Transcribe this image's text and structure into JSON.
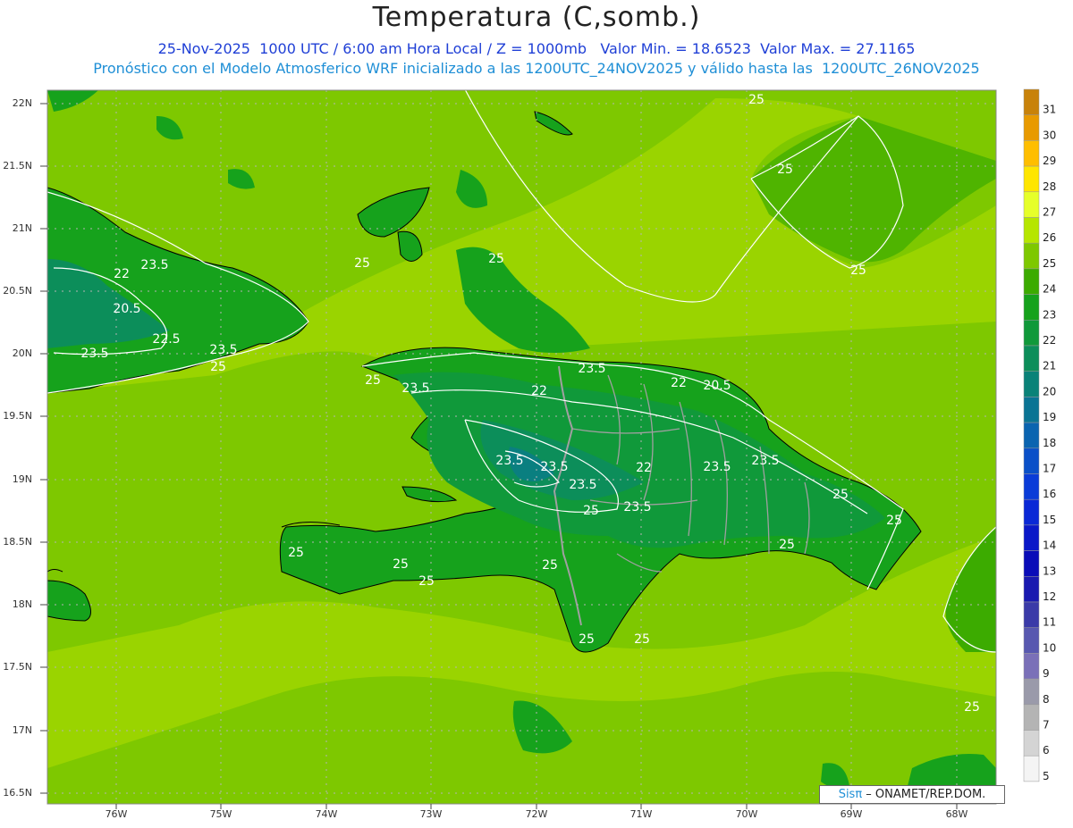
{
  "header": {
    "title": "Temperatura (C,somb.)",
    "line1": "25-Nov-2025  1000 UTC / 6:00 am Hora Local / Z = 1000mb   Valor Min. = 18.6523  Valor Max. = 27.1165",
    "line2": "Pronóstico con el Modelo Atmosferico WRF inicializado a las 1200UTC_24NOV2025 y válido hasta las  1200UTC_26NOV2025"
  },
  "axes": {
    "lat_labels": [
      "22N",
      "21.5N",
      "21N",
      "20.5N",
      "20N",
      "19.5N",
      "19N",
      "18.5N",
      "18N",
      "17.5N",
      "17N",
      "16.5N"
    ],
    "lon_labels": [
      "76W",
      "75W",
      "74W",
      "73W",
      "72W",
      "71W",
      "70W",
      "69W",
      "68W"
    ]
  },
  "legend": {
    "levels": [
      {
        "label": "31",
        "color": "#c8820a"
      },
      {
        "label": "30",
        "color": "#e89a00"
      },
      {
        "label": "29",
        "color": "#ffbe00"
      },
      {
        "label": "28",
        "color": "#ffe600"
      },
      {
        "label": "27",
        "color": "#e6ff2a"
      },
      {
        "label": "26",
        "color": "#b6e600"
      },
      {
        "label": "25",
        "color": "#7ec800"
      },
      {
        "label": "24",
        "color": "#3cab00"
      },
      {
        "label": "23",
        "color": "#16a21c"
      },
      {
        "label": "22",
        "color": "#10993a"
      },
      {
        "label": "21",
        "color": "#0c8e5a"
      },
      {
        "label": "20",
        "color": "#0a8278"
      },
      {
        "label": "19",
        "color": "#0a7494"
      },
      {
        "label": "18",
        "color": "#0a64b0"
      },
      {
        "label": "17",
        "color": "#0a50c8"
      },
      {
        "label": "16",
        "color": "#0a3cd8"
      },
      {
        "label": "15",
        "color": "#0a28d6"
      },
      {
        "label": "14",
        "color": "#0a18c8"
      },
      {
        "label": "13",
        "color": "#0a0cb8"
      },
      {
        "label": "12",
        "color": "#1a1ab0"
      },
      {
        "label": "11",
        "color": "#3a3aa8"
      },
      {
        "label": "10",
        "color": "#5858b0"
      },
      {
        "label": "9",
        "color": "#7a70b8"
      },
      {
        "label": "8",
        "color": "#9a9aaa"
      },
      {
        "label": "7",
        "color": "#b4b4b4"
      },
      {
        "label": "6",
        "color": "#d4d4d4"
      },
      {
        "label": "5",
        "color": "#f4f4f4"
      }
    ]
  },
  "contour_labels": [
    "25",
    "25",
    "25",
    "25",
    "23.5",
    "22",
    "20.5",
    "22.5",
    "23.5",
    "23.5",
    "25",
    "25",
    "23.5",
    "22",
    "25",
    "23.5",
    "22",
    "20.5",
    "23.5",
    "23.5",
    "23.5",
    "22",
    "23.5",
    "23.5",
    "25",
    "23.5",
    "25",
    "25",
    "25",
    "25",
    "25",
    "25",
    "25",
    "25",
    "25",
    "25"
  ],
  "credit": {
    "sis": "Sisπ",
    "org": " – ONAMET/REP.DOM."
  },
  "colors": {
    "sea_light": "#9ad400",
    "sea_mid": "#7ec800",
    "land_24": "#3cab00",
    "land_23": "#16a21c",
    "land_21": "#0c8e5a",
    "coast": "#000000",
    "border": "#a0a0a0",
    "contour": "#ffffff"
  }
}
